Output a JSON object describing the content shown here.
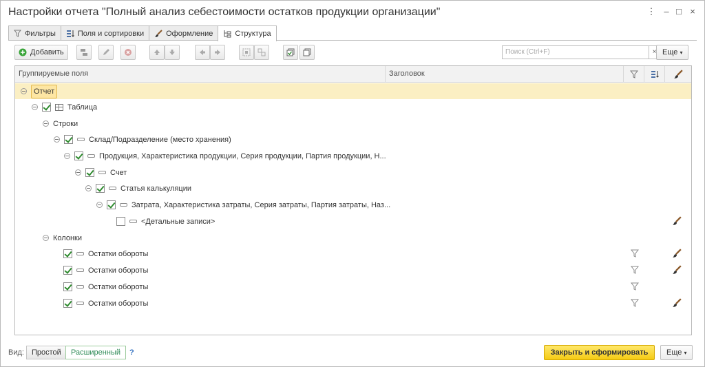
{
  "window": {
    "title": "Настройки отчета \"Полный анализ себестоимости остатков продукции организации\"",
    "menu_glyph": "⋮",
    "minimize_glyph": "–",
    "maximize_glyph": "□",
    "close_glyph": "×"
  },
  "tabs": [
    {
      "label": "Фильтры",
      "icon": "filter-icon"
    },
    {
      "label": "Поля и сортировки",
      "icon": "sort-icon"
    },
    {
      "label": "Оформление",
      "icon": "brush-icon"
    },
    {
      "label": "Структура",
      "icon": "structure-icon",
      "active": true
    }
  ],
  "toolbar": {
    "add_label": "Добавить",
    "search_placeholder": "Поиск (Ctrl+F)",
    "clear_glyph": "×",
    "more_label": "Еще"
  },
  "grid": {
    "columns": [
      "Группируемые поля",
      "Заголовок"
    ],
    "rows": [
      {
        "label": "Отчет",
        "kind": "root",
        "selected": true
      },
      {
        "label": "Таблица",
        "kind": "table",
        "checked": true
      },
      {
        "label": "Строки",
        "kind": "section"
      },
      {
        "label": "Склад/Подразделение (место хранения)",
        "kind": "group",
        "checked": true
      },
      {
        "label": "Продукция, Характеристика продукции, Серия продукции, Партия продукции, Н...",
        "kind": "group",
        "checked": true
      },
      {
        "label": "Счет",
        "kind": "group",
        "checked": true
      },
      {
        "label": "Статья калькуляции",
        "kind": "group",
        "checked": true
      },
      {
        "label": "Затрата, Характеристика затраты, Серия затраты, Партия затраты, Наз...",
        "kind": "group",
        "checked": true
      },
      {
        "label": "<Детальные записи>",
        "kind": "group",
        "checked": false,
        "brush": true
      },
      {
        "label": "Колонки",
        "kind": "section"
      },
      {
        "label": "Остатки обороты",
        "kind": "column",
        "checked": true,
        "filter": true,
        "brush": true
      },
      {
        "label": "Остатки обороты",
        "kind": "column",
        "checked": true,
        "filter": true,
        "brush": true
      },
      {
        "label": "Остатки обороты",
        "kind": "column",
        "checked": true,
        "filter": true,
        "brush": false
      },
      {
        "label": "Остатки обороты",
        "kind": "column",
        "checked": true,
        "filter": true,
        "brush": true
      }
    ]
  },
  "footer": {
    "view_label": "Вид:",
    "simple_label": "Простой",
    "advanced_label": "Расширенный",
    "help_label": "?",
    "close_build_label": "Закрыть и сформировать",
    "more_label": "Еще"
  },
  "colors": {
    "accent_yellow": "#f5cb14",
    "selection": "#fbefc3",
    "check_green": "#2f8b2f",
    "advanced_text": "#2e8b57"
  }
}
